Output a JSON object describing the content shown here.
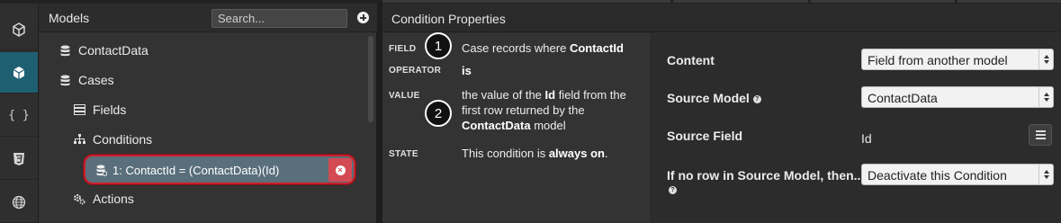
{
  "models_panel": {
    "title": "Models",
    "search_placeholder": "Search...",
    "tree": {
      "model_1": "ContactData",
      "model_2": "Cases",
      "fields": "Fields",
      "conditions": "Conditions",
      "condition_1": "1: ContactId = (ContactData)(Id)",
      "actions": "Actions"
    }
  },
  "rail": {
    "icons": [
      "app-icon",
      "models-icon",
      "code-braces-icon",
      "css-icon",
      "globe-icon"
    ],
    "code_label": "{ }"
  },
  "properties_panel": {
    "title": "Condition Properties",
    "summary": {
      "field_key": "FIELD",
      "field_pre": "Case records where ",
      "field_bold": "ContactId",
      "operator_key": "OPERATOR",
      "operator_val": "is",
      "value_key": "VALUE",
      "value_pre": "the value of the ",
      "value_bold_1": "Id",
      "value_mid": " field from the first row returned by the ",
      "value_bold_2": "ContactData",
      "value_post": " model",
      "state_key": "STATE",
      "state_pre": "This condition is ",
      "state_bold": "always on",
      "state_post": "."
    },
    "callouts": [
      "1",
      "2"
    ],
    "form": {
      "content_label": "Content",
      "content_value": "Field from another model",
      "source_model_label": "Source Model",
      "source_model_value": "ContactData",
      "source_field_label": "Source Field",
      "source_field_value": "Id",
      "no_row_label": "If no row in Source Model, then...",
      "no_row_value": "Deactivate this Condition"
    }
  },
  "colors": {
    "active_rail": "#1f5f72",
    "selected_row": "#5a6f7c",
    "highlight_ring": "#c8202a",
    "delete_button": "#d44a52"
  }
}
